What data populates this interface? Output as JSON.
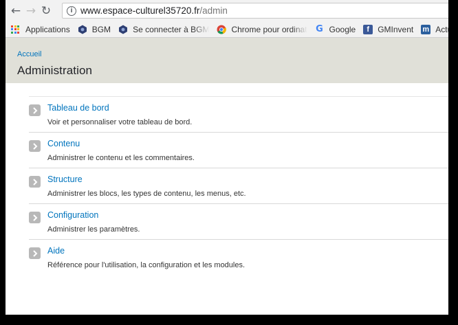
{
  "browser": {
    "url_host": "www.espace-culturel35720.fr",
    "url_path": "/admin"
  },
  "bookmarks": [
    {
      "label": "Applications",
      "icon": "apps-grid-icon"
    },
    {
      "label": "BGM",
      "icon": "bgm-icon"
    },
    {
      "label": "Se connecter à BGM",
      "icon": "bgm-icon"
    },
    {
      "label": "Chrome pour ordinat",
      "icon": "chrome-icon"
    },
    {
      "label": "Google",
      "icon": "google-icon"
    },
    {
      "label": "GMInvent",
      "icon": "facebook-icon"
    },
    {
      "label": "Actualité BGI",
      "icon": "m-icon"
    }
  ],
  "header": {
    "breadcrumb": "Accueil",
    "title": "Administration"
  },
  "admin_items": [
    {
      "title": "Tableau de bord",
      "description": "Voir et personnaliser votre tableau de bord."
    },
    {
      "title": "Contenu",
      "description": "Administrer le contenu et les commentaires."
    },
    {
      "title": "Structure",
      "description": "Administrer les blocs, les types de contenu, les menus, etc."
    },
    {
      "title": "Configuration",
      "description": "Administrer les paramètres."
    },
    {
      "title": "Aide",
      "description": "Référence pour l'utilisation, la configuration et les modules."
    }
  ],
  "colors": {
    "link": "#0074bd",
    "header_bg": "#e0e0d8",
    "chevron_bg": "#b8b8b8"
  }
}
